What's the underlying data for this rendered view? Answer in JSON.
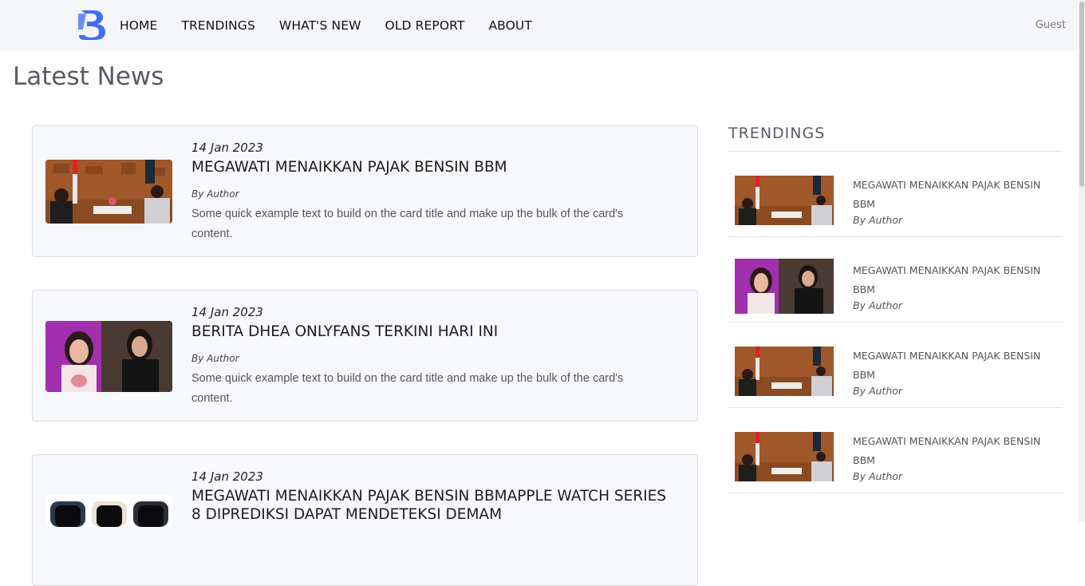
{
  "nav": {
    "links": [
      "HOME",
      "TRENDINGS",
      "WHAT'S NEW",
      "OLD REPORT",
      "ABOUT"
    ],
    "user": "Guest",
    "logo_icon": "brand-b-logo-icon"
  },
  "main": {
    "title": "Latest News",
    "cards": [
      {
        "date": "14 Jan 2023",
        "title": "MEGAWATI MENAIKKAN PAJAK BENSIN BBM",
        "author": "By Author",
        "text": "Some quick example text to build on the card title and make up the bulk of the card's content.",
        "image": "press-conference-photo"
      },
      {
        "date": "14 Jan 2023",
        "title": "BERITA DHEA ONLYFANS TERKINI HARI INI",
        "author": "By Author",
        "text": "Some quick example text to build on the card title and make up the bulk of the card's content.",
        "image": "portrait-photo"
      },
      {
        "date": "14 Jan 2023",
        "title": "MEGAWATI MENAIKKAN PAJAK BENSIN BBMAPPLE WATCH SERIES 8 DIPREDIKSI DAPAT MENDETEKSI DEMAM",
        "author": "",
        "text": "",
        "image": "smartwatch-photo"
      }
    ]
  },
  "sidebar": {
    "title": "TRENDINGS",
    "items": [
      {
        "title": "MEGAWATI MENAIKKAN PAJAK BENSIN BBM",
        "author": "By Author",
        "image": "press-conference-photo"
      },
      {
        "title": "MEGAWATI MENAIKKAN PAJAK BENSIN BBM",
        "author": "By Author",
        "image": "portrait-photo"
      },
      {
        "title": "MEGAWATI MENAIKKAN PAJAK BENSIN BBM",
        "author": "By Author",
        "image": "press-conference-photo"
      },
      {
        "title": "MEGAWATI MENAIKKAN PAJAK BENSIN BBM",
        "author": "By Author",
        "image": "press-conference-photo"
      }
    ]
  },
  "colors": {
    "navbar_bg": "#f5f6fa",
    "logo_blue": "#3f6ff0",
    "card_bg": "#f7f8fb",
    "card_border": "#d9dbe0",
    "heading_gray": "#5b5b66"
  }
}
